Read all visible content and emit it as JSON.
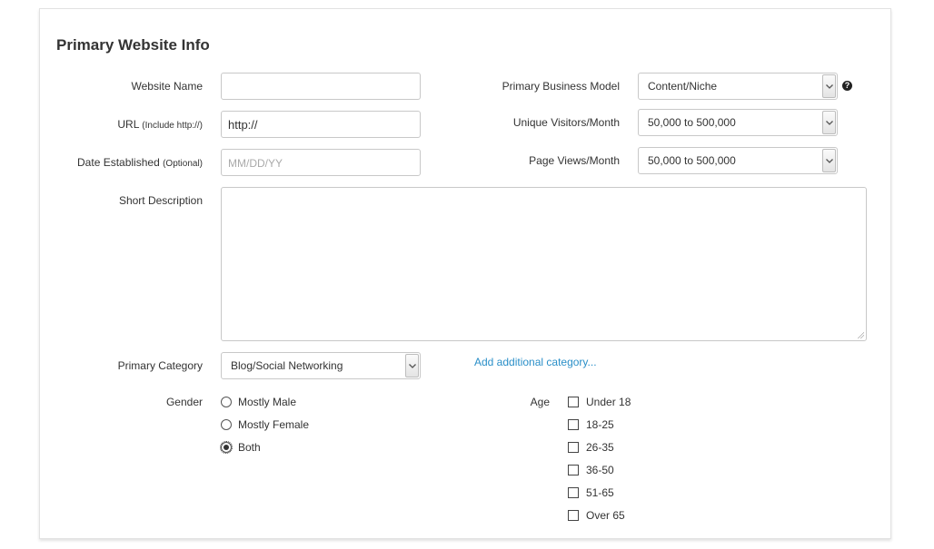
{
  "form": {
    "title": "Primary Website Info",
    "website_name": {
      "label": "Website Name",
      "value": "",
      "placeholder": ""
    },
    "url": {
      "label": "URL",
      "hint": "(Include http://)",
      "value": "http://"
    },
    "date_established": {
      "label": "Date Established",
      "hint": "(Optional)",
      "value": "",
      "placeholder": "MM/DD/YY"
    },
    "business_model": {
      "label": "Primary Business Model",
      "value": "Content/Niche",
      "help_glyph": "?"
    },
    "unique_visitors": {
      "label": "Unique Visitors/Month",
      "value": "50,000 to 500,000"
    },
    "page_views": {
      "label": "Page Views/Month",
      "value": "50,000 to 500,000"
    },
    "short_description": {
      "label": "Short Description",
      "value": ""
    },
    "primary_category": {
      "label": "Primary Category",
      "value": "Blog/Social Networking"
    },
    "add_category_link": "Add additional category...",
    "gender": {
      "label": "Gender",
      "options": [
        "Mostly Male",
        "Mostly Female",
        "Both"
      ],
      "selected": "Both"
    },
    "age": {
      "label": "Age",
      "options": [
        "Under 18",
        "18-25",
        "26-35",
        "36-50",
        "51-65",
        "Over 65"
      ],
      "checked": []
    }
  },
  "colors": {
    "link": "#2a8fc8",
    "border": "#c8c8c8",
    "text": "#333333"
  }
}
